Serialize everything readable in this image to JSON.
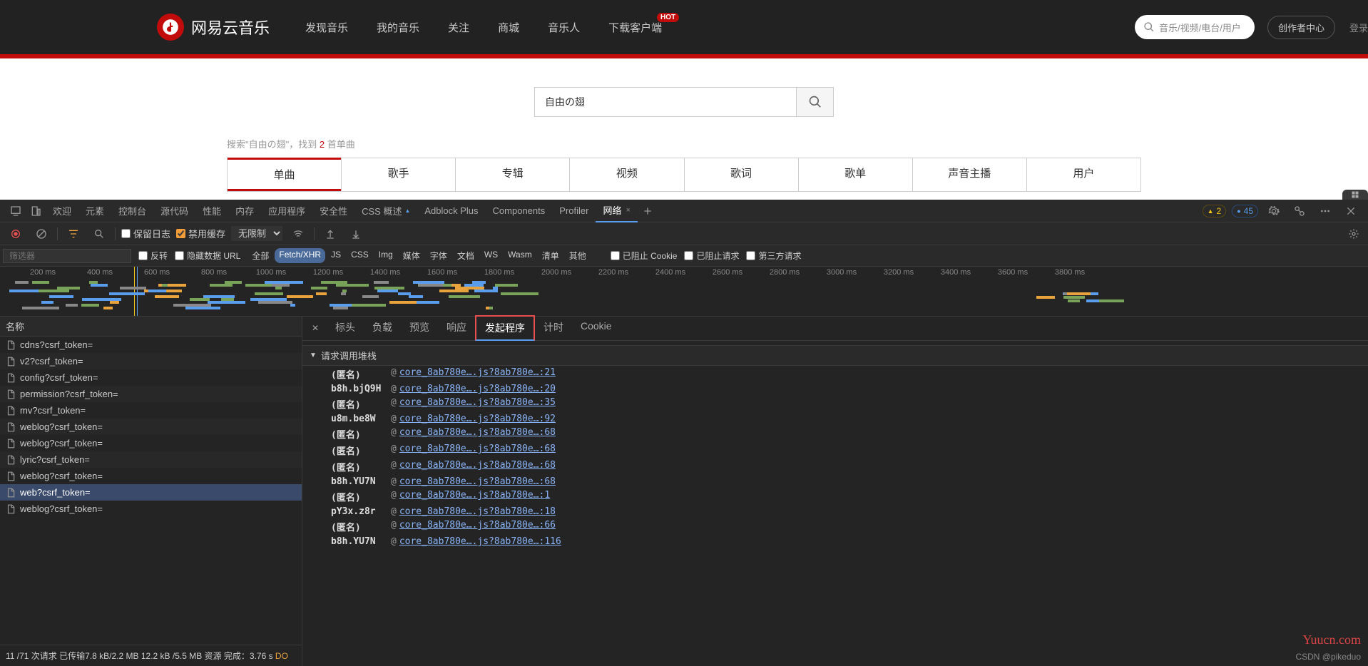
{
  "site": {
    "brand": "网易云音乐",
    "nav": [
      "发现音乐",
      "我的音乐",
      "关注",
      "商城",
      "音乐人",
      "下载客户端"
    ],
    "hot": "HOT",
    "search_placeholder": "音乐/视频/电台/用户",
    "creator": "创作者中心",
    "login": "登录"
  },
  "page": {
    "search_value": "自由の翅",
    "result_prefix": "搜索\"自由の翅\"，找到 ",
    "result_count": "2",
    "result_suffix": " 首单曲",
    "tabs": [
      "单曲",
      "歌手",
      "专辑",
      "视频",
      "歌词",
      "歌单",
      "声音主播",
      "用户"
    ]
  },
  "devtools": {
    "tabs": [
      "欢迎",
      "元素",
      "控制台",
      "源代码",
      "性能",
      "内存",
      "应用程序",
      "安全性",
      "CSS 概述",
      "Adblock Plus",
      "Components",
      "Profiler",
      "网络"
    ],
    "warn_count": "2",
    "info_count": "45",
    "toolbar": {
      "preserve": "保留日志",
      "disable_cache": "禁用缓存",
      "throttling": "无限制"
    },
    "filter": {
      "placeholder": "筛选器",
      "invert": "反转",
      "hide_data": "隐藏数据 URL",
      "types": [
        "全部",
        "Fetch/XHR",
        "JS",
        "CSS",
        "Img",
        "媒体",
        "字体",
        "文档",
        "WS",
        "Wasm",
        "清单",
        "其他"
      ],
      "blocked_cookie": "已阻止 Cookie",
      "blocked_req": "已阻止请求",
      "third_party": "第三方请求"
    },
    "timeline_ticks": [
      "200 ms",
      "400 ms",
      "600 ms",
      "800 ms",
      "1000 ms",
      "1200 ms",
      "1400 ms",
      "1600 ms",
      "1800 ms",
      "2000 ms",
      "2200 ms",
      "2400 ms",
      "2600 ms",
      "2800 ms",
      "3000 ms",
      "3200 ms",
      "3400 ms",
      "3600 ms",
      "3800 ms"
    ],
    "name_col": "名称",
    "requests": [
      "cdns?csrf_token=",
      "v2?csrf_token=",
      "config?csrf_token=",
      "permission?csrf_token=",
      "mv?csrf_token=",
      "weblog?csrf_token=",
      "weblog?csrf_token=",
      "lyric?csrf_token=",
      "weblog?csrf_token=",
      "web?csrf_token=",
      "weblog?csrf_token="
    ],
    "selected_index": 9,
    "status": "11 /71 次请求   已传输7.8 kB/2.2 MB   12.2 kB /5.5 MB 资源   完成：3.76 s   ",
    "status_warn": "DO",
    "detail_tabs": [
      "标头",
      "负载",
      "预览",
      "响应",
      "发起程序",
      "计时",
      "Cookie"
    ],
    "stack_title": "请求调用堆栈",
    "stack": [
      {
        "fn": "(匿名)",
        "link": "core_8ab780e….js?8ab780e…:21"
      },
      {
        "fn": "b8h.bjQ9H",
        "link": "core_8ab780e….js?8ab780e…:20"
      },
      {
        "fn": "(匿名)",
        "link": "core_8ab780e….js?8ab780e…:35"
      },
      {
        "fn": "u8m.be8W",
        "link": "core_8ab780e….js?8ab780e…:92"
      },
      {
        "fn": "(匿名)",
        "link": "core_8ab780e….js?8ab780e…:68"
      },
      {
        "fn": "(匿名)",
        "link": "core_8ab780e….js?8ab780e…:68"
      },
      {
        "fn": "(匿名)",
        "link": "core_8ab780e….js?8ab780e…:68"
      },
      {
        "fn": "b8h.YU7N",
        "link": "core_8ab780e….js?8ab780e…:68"
      },
      {
        "fn": "(匿名)",
        "link": "core_8ab780e….js?8ab780e…:1"
      },
      {
        "fn": "pY3x.z8r",
        "link": "core_8ab780e….js?8ab780e…:18"
      },
      {
        "fn": "(匿名)",
        "link": "core_8ab780e….js?8ab780e…:66"
      },
      {
        "fn": "b8h.YU7N",
        "link": "core_8ab780e….js?8ab780e…:116"
      }
    ]
  },
  "watermark": "Yuucn.com",
  "csdn": "CSDN @pikeduo"
}
